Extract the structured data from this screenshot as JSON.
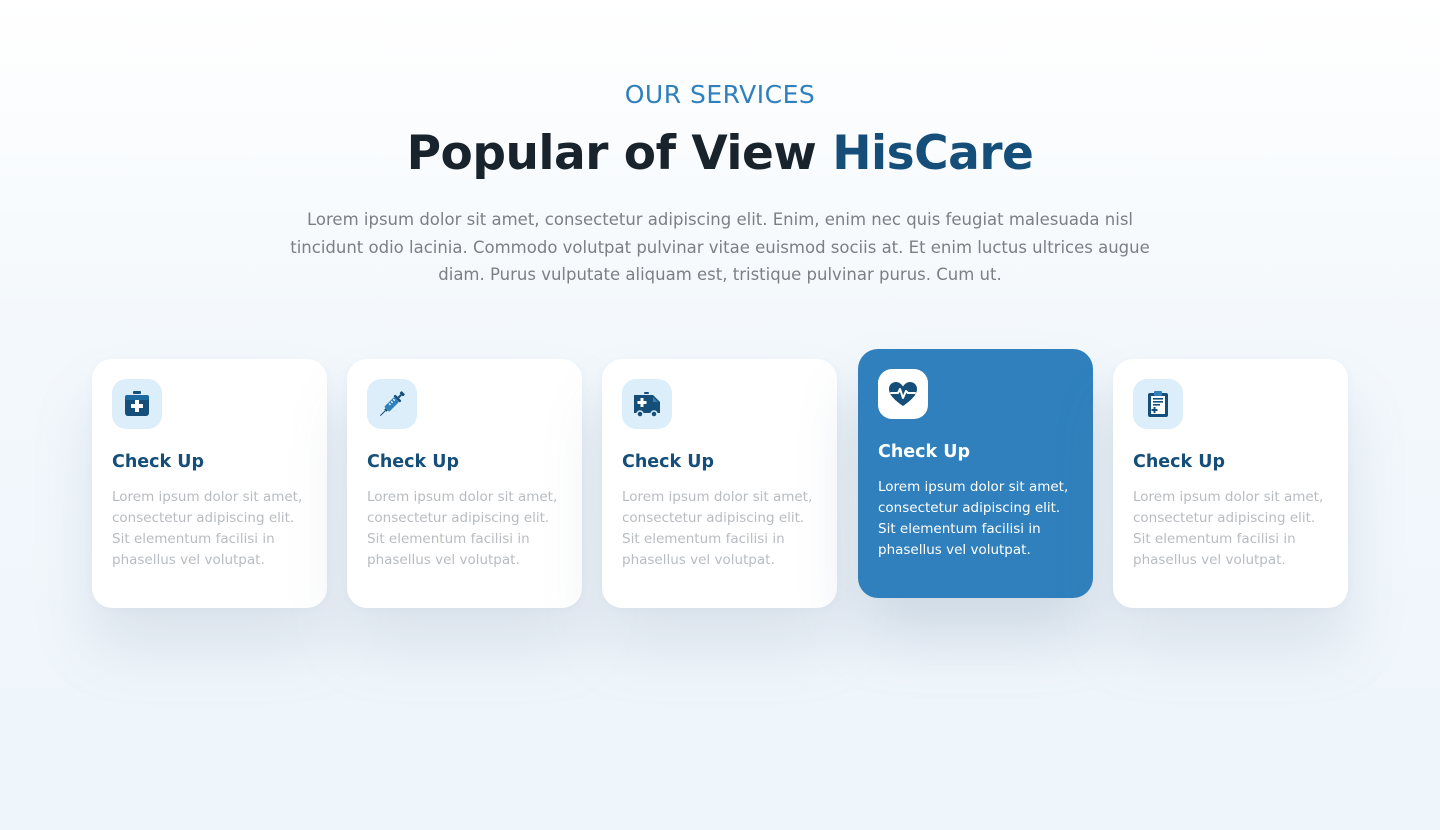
{
  "section": {
    "eyebrow": "OUR SERVICES",
    "title_main": "Popular of View ",
    "title_accent": "HisCare",
    "description": "Lorem ipsum dolor sit amet, consectetur adipiscing elit. Enim, enim nec quis feugiat malesuada nisl tincidunt odio lacinia. Commodo volutpat pulvinar vitae euismod sociis at. Et enim luctus ultrices augue diam. Purus vulputate aliquam est, tristique pulvinar purus. Cum ut."
  },
  "colors": {
    "accent": "#2f80bd",
    "dark_blue": "#154f79",
    "heading": "#18232c",
    "icon_bg": "#dceefa"
  },
  "cards": [
    {
      "icon": "first-aid-kit-icon",
      "title": "Check Up",
      "text": "Lorem ipsum dolor sit amet, consectetur adipiscing elit. Sit elementum facilisi in phasellus vel volutpat.",
      "active": false
    },
    {
      "icon": "syringe-icon",
      "title": "Check Up",
      "text": "Lorem ipsum dolor sit amet, consectetur adipiscing elit. Sit elementum facilisi in phasellus vel volutpat.",
      "active": false
    },
    {
      "icon": "ambulance-icon",
      "title": "Check Up",
      "text": "Lorem ipsum dolor sit amet, consectetur adipiscing elit. Sit elementum facilisi in phasellus vel volutpat.",
      "active": false
    },
    {
      "icon": "heartbeat-icon",
      "title": "Check Up",
      "text": "Lorem ipsum dolor sit amet, consectetur adipiscing elit. Sit elementum facilisi in phasellus vel volutpat.",
      "active": true
    },
    {
      "icon": "medical-clipboard-icon",
      "title": "Check Up",
      "text": "Lorem ipsum dolor sit amet, consectetur adipiscing elit. Sit elementum facilisi in phasellus vel volutpat.",
      "active": false
    }
  ]
}
